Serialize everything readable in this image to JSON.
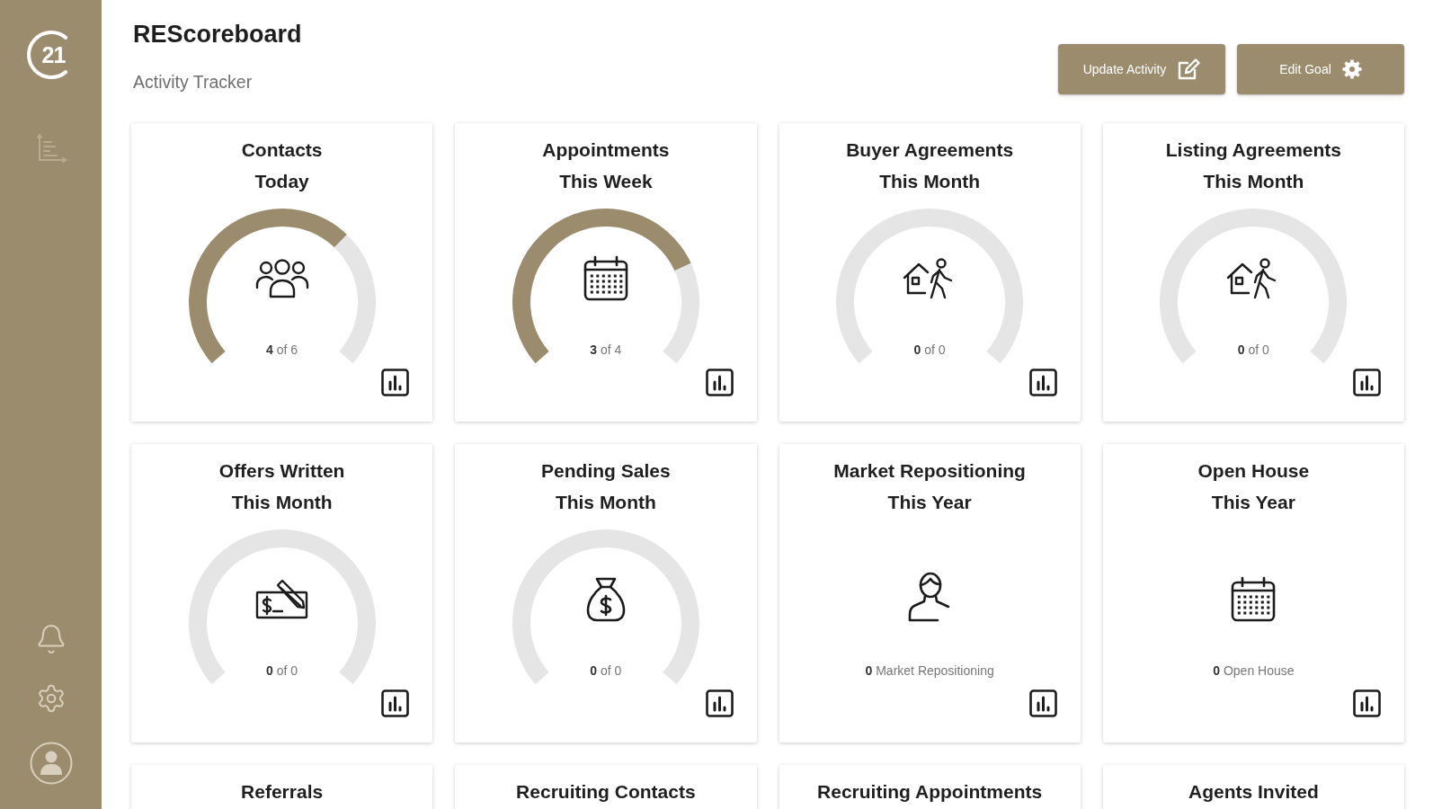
{
  "sidebar": {
    "logo_text": "21"
  },
  "header": {
    "title": "REScoreboard",
    "subtitle": "Activity Tracker",
    "buttons": [
      "Update Activity",
      "Edit Goal"
    ]
  },
  "cards": [
    {
      "title_lines": [
        "Contacts",
        "Today"
      ],
      "kind": "gauge",
      "chart_data": {
        "type": "donut",
        "values": [
          66.7,
          33.3
        ],
        "colors": [
          "#9c8c6e",
          "#e5e5e5"
        ]
      },
      "reading": "**4** of 6"
    },
    {
      "title_lines": [
        "Appointments",
        "This Week"
      ],
      "kind": "gauge",
      "chart_data": {
        "type": "donut",
        "values": [
          75,
          25
        ],
        "colors": [
          "#9c8c6e",
          "#e5e5e5"
        ]
      },
      "reading": "**3** of 4"
    },
    {
      "title_lines": [
        "Buyer Agreements",
        "This Month"
      ],
      "kind": "gauge",
      "reading": "**0** of 0"
    },
    {
      "title_lines": [
        "Listing Agreements",
        "This Month"
      ],
      "kind": "gauge",
      "reading": "**0** of 0"
    },
    {
      "title_lines": [
        "Offers Written",
        "This Month"
      ],
      "kind": "gauge",
      "reading": "**0** of 0"
    },
    {
      "title_lines": [
        "Pending Sales",
        "This Month"
      ],
      "kind": "gauge",
      "reading": "**0** of 0"
    },
    {
      "title_lines": [
        "Market Repositioning",
        "This Year"
      ],
      "kind": "count",
      "reading": "**0** Market Repositioning"
    },
    {
      "title_lines": [
        "Open House",
        "This Year"
      ],
      "kind": "count",
      "reading": "**0** Open House"
    },
    {
      "title_lines": [
        "Referrals"
      ]
    },
    {
      "title_lines": [
        "Recruiting Contacts"
      ]
    },
    {
      "title_lines": [
        "Recruiting Appointments"
      ]
    },
    {
      "title_lines": [
        "Agents Invited"
      ]
    }
  ]
}
